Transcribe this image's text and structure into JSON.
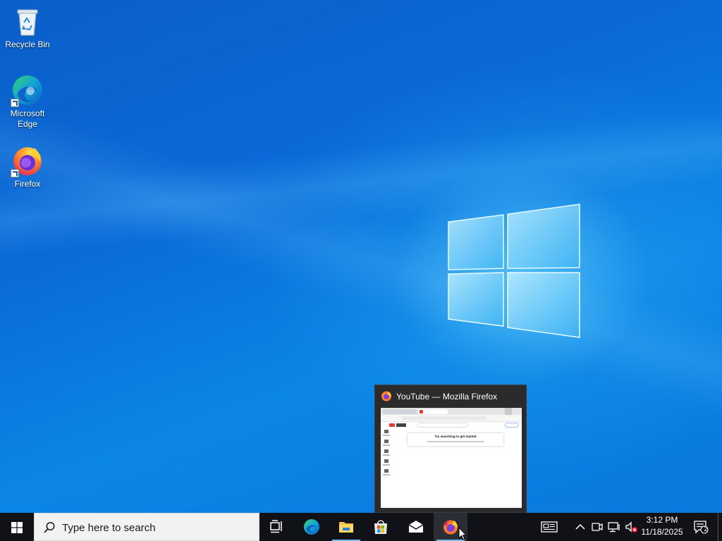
{
  "desktop": {
    "icons": [
      {
        "label": "Recycle Bin"
      },
      {
        "label": "Microsoft Edge"
      },
      {
        "label": "Firefox"
      }
    ]
  },
  "preview": {
    "title": "YouTube — Mozilla Firefox",
    "page_heading": "Try searching to get started"
  },
  "taskbar": {
    "search_placeholder": "Type here to search",
    "apps": [
      {
        "name": "Task View"
      },
      {
        "name": "Microsoft Edge"
      },
      {
        "name": "File Explorer"
      },
      {
        "name": "Microsoft Store"
      },
      {
        "name": "Mail"
      },
      {
        "name": "Firefox",
        "active": true
      }
    ],
    "tray": {
      "time": "3:12 PM",
      "date": "11/18/2025",
      "notification_count": "2"
    }
  },
  "colors": {
    "taskbar_bg": "#101217",
    "accent_underline": "#76b9ed",
    "desktop_blue": "#0a72d6"
  }
}
